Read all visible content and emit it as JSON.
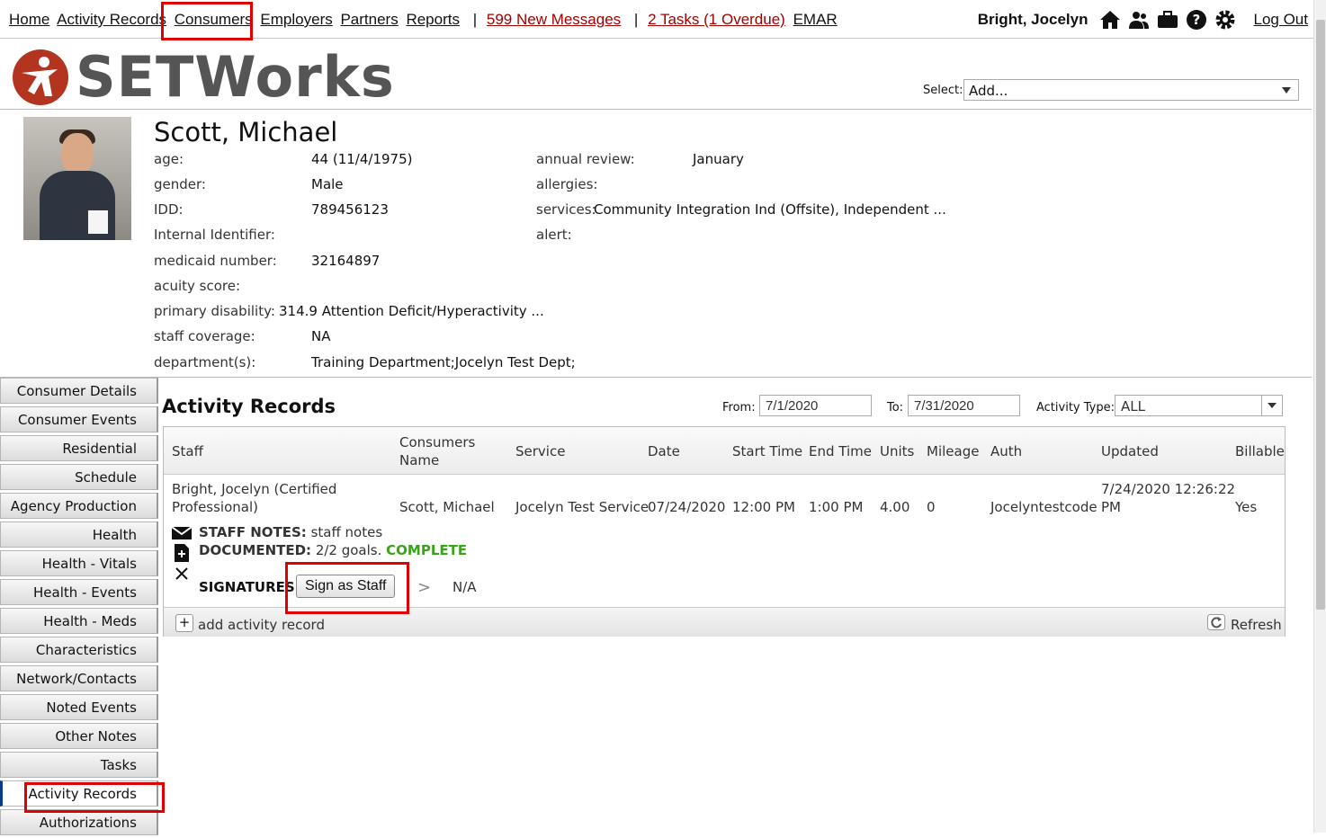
{
  "topnav": {
    "home": "Home",
    "activity_records": "Activity Records",
    "consumers": "Consumers",
    "employers": "Employers",
    "partners": "Partners",
    "reports": "Reports",
    "sep": "|",
    "messages": "599 New Messages",
    "tasks": "2 Tasks (1 Overdue)",
    "emar": "EMAR",
    "user": "Bright, Jocelyn",
    "logout": "Log Out"
  },
  "logo": {
    "text": "SETWorks",
    "brand_color": "#b3351f"
  },
  "select": {
    "label": "Select:",
    "value": "Add..."
  },
  "consumer": {
    "name": "Scott, Michael",
    "fields": {
      "age": {
        "label": "age:",
        "value": "44 (11/4/1975)"
      },
      "gender": {
        "label": "gender:",
        "value": "Male"
      },
      "idd": {
        "label": "IDD:",
        "value": "789456123"
      },
      "internal": {
        "label": "Internal Identifier:",
        "value": ""
      },
      "medicaid": {
        "label": "medicaid number:",
        "value": "32164897"
      },
      "acuity": {
        "label": "acuity score:",
        "value": ""
      },
      "primary": {
        "label": "primary disability:",
        "value": "314.9 Attention Deficit/Hyperactivity ..."
      },
      "staff": {
        "label": "staff coverage:",
        "value": "NA"
      },
      "dept": {
        "label": "department(s):",
        "value": "Training Department;Jocelyn Test Dept;"
      },
      "annual": {
        "label": "annual review:",
        "value": "January"
      },
      "allergies": {
        "label": "allergies:",
        "value": ""
      },
      "services": {
        "label": "services:",
        "value": "Community Integration Ind (Offsite), Independent ..."
      },
      "alert": {
        "label": "alert:",
        "value": ""
      }
    }
  },
  "sidebar": {
    "items": [
      "Consumer Details",
      "Consumer Events",
      "Residential",
      "Schedule",
      "Agency Production",
      "Health",
      "Health - Vitals",
      "Health - Events",
      "Health - Meds",
      "Characteristics",
      "Network/Contacts",
      "Noted Events",
      "Other Notes",
      "Tasks",
      "Activity Records",
      "Authorizations"
    ]
  },
  "activity": {
    "title": "Activity Records",
    "from_label": "From:",
    "from_value": "7/1/2020",
    "to_label": "To:",
    "to_value": "7/31/2020",
    "type_label": "Activity Type:",
    "type_value": "ALL",
    "columns": {
      "staff": "Staff",
      "consumers_name_1": "Consumers",
      "consumers_name_2": "Name",
      "service": "Service",
      "date": "Date",
      "start": "Start Time",
      "end": "End Time",
      "units": "Units",
      "mileage": "Mileage",
      "auth": "Auth",
      "updated": "Updated",
      "billable": "Billable"
    },
    "row": {
      "staff_1": "Bright, Jocelyn (Certified",
      "staff_2": "Professional)",
      "consumer": "Scott, Michael",
      "service": "Jocelyn Test Service",
      "date": "07/24/2020",
      "start": "12:00 PM",
      "end": "1:00 PM",
      "units": "4.00",
      "mileage": "0",
      "auth": "Jocelyntestcode",
      "updated_1": "7/24/2020 12:26:22",
      "updated_2": "PM",
      "billable": "Yes"
    },
    "notes_label": "STAFF NOTES:",
    "notes_value": "staff notes",
    "documented_label": "DOCUMENTED:",
    "documented_value": "2/2 goals.",
    "documented_status": "COMPLETE",
    "signatures_label": "SIGNATURES:",
    "sign_button": "Sign as Staff",
    "arrow": ">",
    "na": "N/A",
    "add_record": "add activity record",
    "refresh": "Refresh",
    "complete_color": "#3aa21c"
  }
}
